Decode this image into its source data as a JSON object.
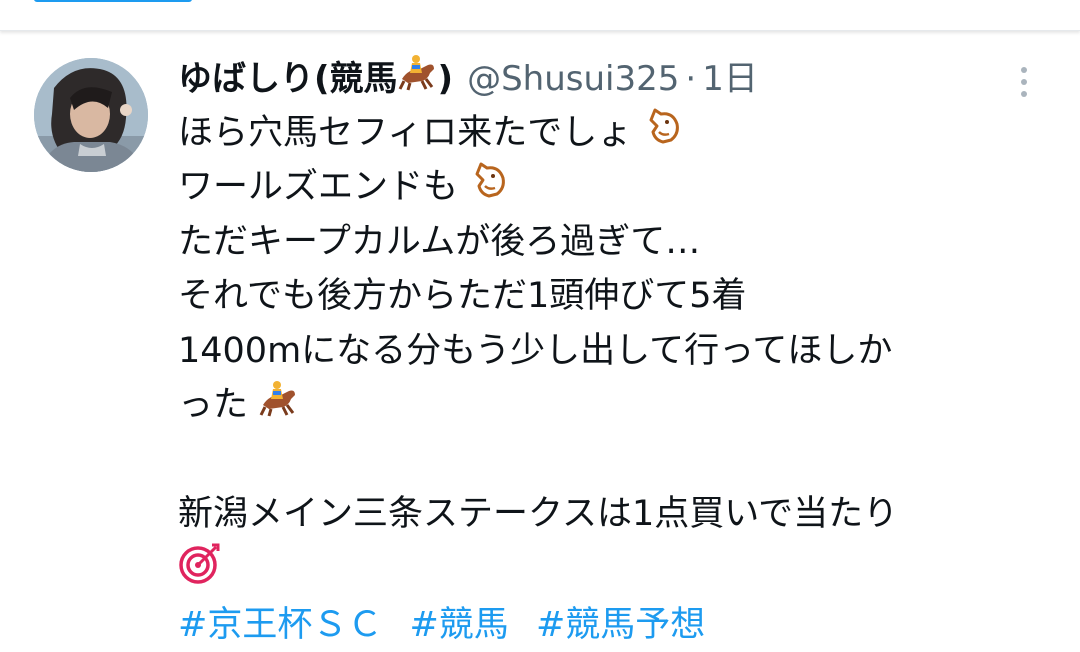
{
  "tweet": {
    "display_name": "ゆばしり(競馬",
    "display_name_suffix": ")",
    "handle": "@Shusui325",
    "separator": "·",
    "time": "1日",
    "lines": [
      "ほら穴馬セフィロ来たでしょ",
      "ワールズエンドも",
      "ただキープカルムが後ろ過ぎて…",
      "それでも後方からただ1頭伸びて5着",
      "1400mになる分もう少し出して行ってほしか",
      "った",
      "",
      "新潟メイン三条ステークスは1点買いで当たり"
    ],
    "hashtags": [
      "#京王杯ＳＣ",
      "#競馬",
      "#競馬予想"
    ]
  },
  "icons": {
    "name_emoji": "horse-racing-icon",
    "line1_emoji": "horse-face-icon",
    "line2_emoji": "horse-face-icon",
    "line6_emoji": "horse-racing-icon",
    "line9_emoji": "direct-hit-icon",
    "more": "more-vertical-icon"
  },
  "colors": {
    "link": "#1d9bf0",
    "secondary_text": "#536471",
    "primary_text": "#0f1419"
  }
}
